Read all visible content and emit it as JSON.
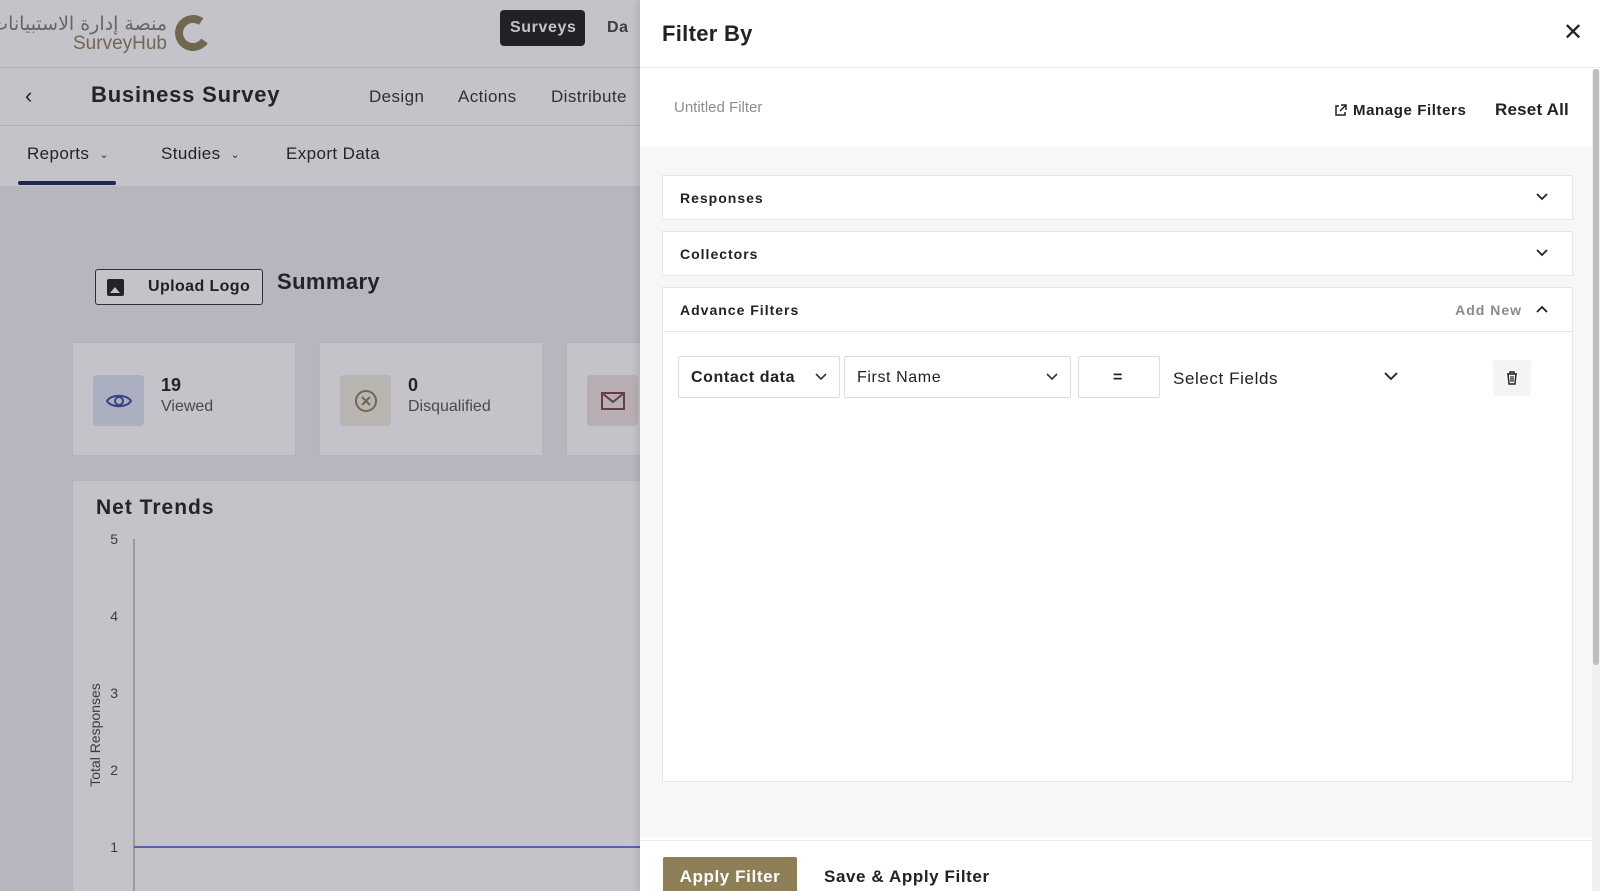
{
  "brand": {
    "logo_arabic": "منصة إدارة الاستبيانات",
    "logo_english": "SurveyHub"
  },
  "topnav": {
    "active": "Surveys",
    "next_partial": "Da"
  },
  "survey": {
    "title": "Business Survey",
    "tabs": [
      "Design",
      "Actions",
      "Distribute"
    ]
  },
  "report_tabs": {
    "reports": "Reports",
    "studies": "Studies",
    "export": "Export Data"
  },
  "summary": {
    "upload_logo": "Upload Logo",
    "title": "Summary",
    "stats": [
      {
        "value": "19",
        "label": "Viewed",
        "icon": "eye-icon",
        "bg": "#dfe3f3",
        "color": "#3f4fa0"
      },
      {
        "value": "0",
        "label": "Disqualified",
        "icon": "x-circle-icon",
        "bg": "#efeadf",
        "color": "#8e7f57"
      },
      {
        "value": "",
        "label": "",
        "icon": "mail-icon",
        "bg": "#f0e3e3",
        "color": "#7a4a4a"
      }
    ]
  },
  "chart_data": {
    "type": "line",
    "title": "Net Trends",
    "ylabel": "Total Responses",
    "yticks": [
      5,
      4,
      3,
      2,
      1
    ],
    "ylim": [
      0,
      5
    ],
    "series": [
      {
        "values": [
          1,
          1
        ]
      }
    ],
    "grid": false
  },
  "filter_panel": {
    "title": "Filter By",
    "filter_name": "Untitled Filter",
    "manage_filters": "Manage Filters",
    "reset_all": "Reset All",
    "sections": {
      "responses": "Responses",
      "collectors": "Collectors",
      "advance": "Advance Filters",
      "add_new": "Add New"
    },
    "rule": {
      "source": "Contact data",
      "field": "First Name",
      "operator": "=",
      "value": "Select Fields"
    },
    "apply": "Apply Filter",
    "save_apply": "Save & Apply Filter"
  },
  "colors": {
    "brand_gold": "#8e7f57",
    "dark": "#1f1f1f",
    "chart_line": "#3f4fc0"
  }
}
